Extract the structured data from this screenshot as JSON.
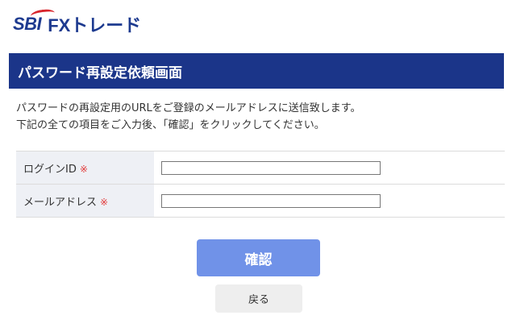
{
  "logo": {
    "brand": "SBI",
    "product": "FXトレード"
  },
  "page": {
    "title": "パスワード再設定依頼画面",
    "description_line1": "パスワードの再設定用のURLをご登録のメールアドレスに送信致します。",
    "description_line2": "下記の全ての項目をご入力後、「確認」をクリックしてください。"
  },
  "form": {
    "required_mark": "※",
    "fields": [
      {
        "label": "ログインID",
        "value": ""
      },
      {
        "label": "メールアドレス",
        "value": ""
      }
    ]
  },
  "actions": {
    "confirm_label": "確認",
    "back_label": "戻る"
  },
  "colors": {
    "brand_navy": "#1b3589",
    "logo_red": "#d8262c",
    "confirm_button": "#7092e8",
    "required_red": "#e23a3a"
  }
}
